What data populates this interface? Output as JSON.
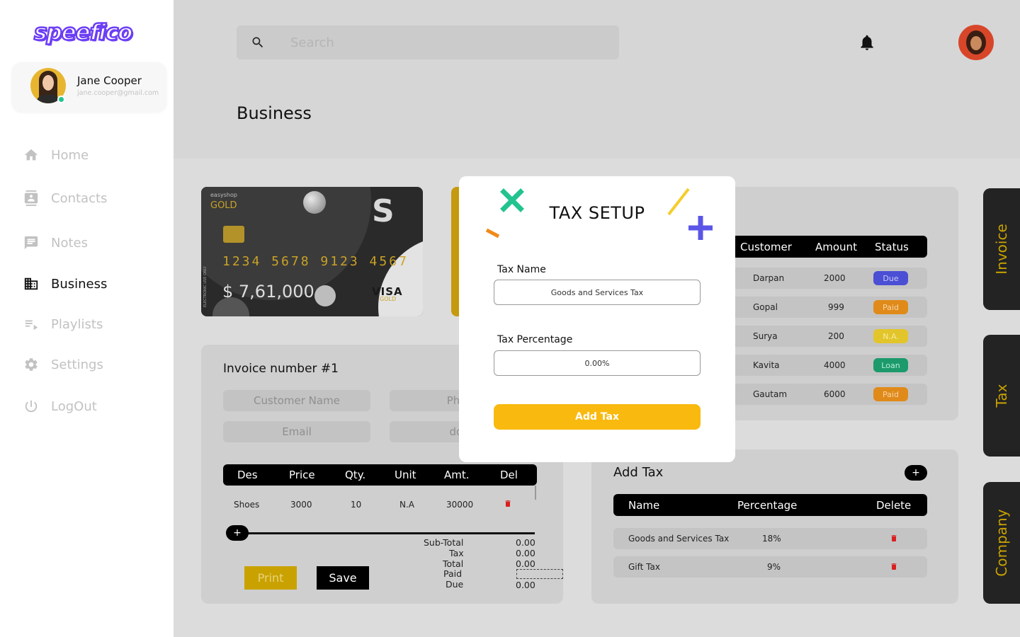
{
  "app": {
    "logo": "speefico"
  },
  "profile": {
    "name": "Jane Cooper",
    "email": "jane.cooper@gmail.com"
  },
  "nav": [
    {
      "label": "Home",
      "icon": "home-icon"
    },
    {
      "label": "Contacts",
      "icon": "contacts-icon"
    },
    {
      "label": "Notes",
      "icon": "notes-icon"
    },
    {
      "label": "Business",
      "icon": "business-icon",
      "active": true
    },
    {
      "label": "Playlists",
      "icon": "playlist-icon"
    },
    {
      "label": "Settings",
      "icon": "gear-icon"
    },
    {
      "label": "LogOut",
      "icon": "power-icon"
    }
  ],
  "search": {
    "placeholder": "Search",
    "value": ""
  },
  "page": {
    "title": "Business"
  },
  "card": {
    "shop": "easyshop",
    "tier": "GOLD",
    "logo_letter": "S",
    "number": "1234 5678 9123 4567",
    "side_text": "ELECTRONIC USE ONLY",
    "balance": "$ 7,61,000",
    "network": "VISA",
    "network_sub": "GOLD"
  },
  "invoice": {
    "title": "Invoice number #1",
    "fields": {
      "customer_name": "Customer Name",
      "phone": "Phone",
      "email": "Email",
      "date": "dd-m"
    },
    "columns": [
      "Des",
      "Price",
      "Qty.",
      "Unit",
      "Amt.",
      "Del"
    ],
    "rows": [
      {
        "des": "Shoes",
        "price": "3000",
        "qty": "10",
        "unit": "N.A",
        "amt": "30000"
      }
    ],
    "add_label": "+",
    "totals": {
      "subtotal_label": "Sub-Total",
      "subtotal": "0.00",
      "tax_label": "Tax",
      "tax": "0.00",
      "total_label": "Total",
      "total": "0.00",
      "paid_label": "Paid",
      "paid": "",
      "due_label": "Due",
      "due": "0.00"
    },
    "print_label": "Print",
    "save_label": "Save"
  },
  "customers": {
    "columns": [
      "Customer",
      "Amount",
      "Status"
    ],
    "rows": [
      {
        "name": "Darpan",
        "amount": "2000",
        "status": "Due",
        "status_bg": "#4b4fd4",
        "status_fg": "#c9cbf5"
      },
      {
        "name": "Gopal",
        "amount": "999",
        "status": "Paid",
        "status_bg": "#e08a1a",
        "status_fg": "#f6d6a8"
      },
      {
        "name": "Surya",
        "amount": "200",
        "status": "N.A.",
        "status_bg": "#e2c52b",
        "status_fg": "#f6ea9c"
      },
      {
        "name": "Kavita",
        "amount": "4000",
        "status": "Loan",
        "status_bg": "#1c9a6c",
        "status_fg": "#b6eed6"
      },
      {
        "name": "Gautam",
        "amount": "6000",
        "status": "Paid",
        "status_bg": "#e08a1a",
        "status_fg": "#f6d6a8"
      }
    ]
  },
  "tax_panel": {
    "title": "Add Tax",
    "add_label": "+",
    "columns": [
      "Name",
      "Percentage",
      "Delete"
    ],
    "rows": [
      {
        "name": "Goods and Services Tax",
        "percentage": "18%"
      },
      {
        "name": "Gift Tax",
        "percentage": "9%"
      }
    ]
  },
  "side_tabs": [
    "Invoice",
    "Tax",
    "Company"
  ],
  "modal": {
    "title": "TAX SETUP",
    "tax_name_label": "Tax Name",
    "tax_name_value": "Goods and Services Tax",
    "tax_pct_label": "Tax Percentage",
    "tax_pct_value": "0.00%",
    "button_label": "Add Tax"
  },
  "colors": {
    "accent": "#f9b90f",
    "logo": "#6c3ef5",
    "overlay": "#dcdcdc",
    "tab_text": "#c9a200",
    "delete": "#d91f1f"
  }
}
